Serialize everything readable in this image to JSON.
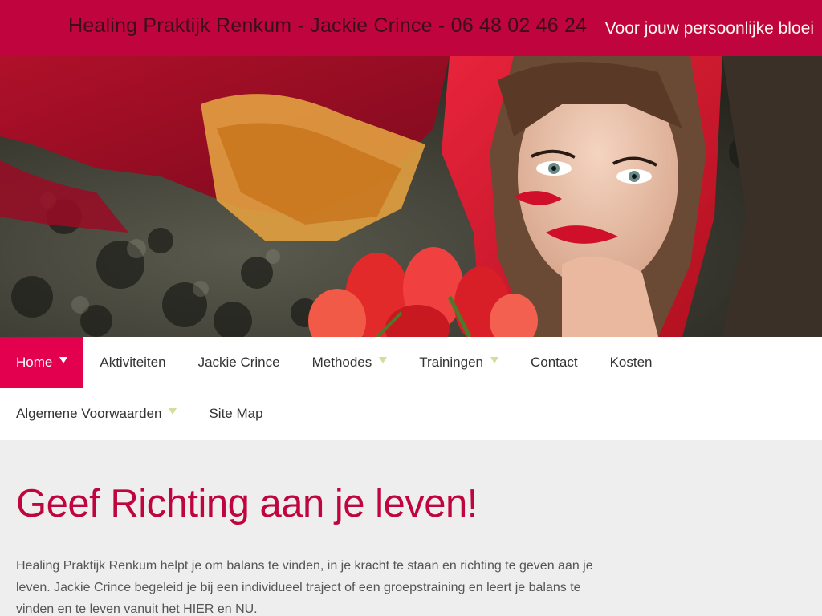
{
  "header": {
    "site_title": "Healing Praktijk Renkum - Jackie Crince - 06 48 02 46 24",
    "tagline": "Voor jouw persoonlijke bloei"
  },
  "hero": {
    "description": ""
  },
  "nav": {
    "row1": [
      {
        "label": "Home",
        "active": true,
        "has_submenu": true
      },
      {
        "label": "Aktiviteiten",
        "active": false,
        "has_submenu": false
      },
      {
        "label": "Jackie Crince",
        "active": false,
        "has_submenu": false
      },
      {
        "label": "Methodes",
        "active": false,
        "has_submenu": true
      },
      {
        "label": "Trainingen",
        "active": false,
        "has_submenu": true
      },
      {
        "label": "Contact",
        "active": false,
        "has_submenu": false
      },
      {
        "label": "Kosten",
        "active": false,
        "has_submenu": false
      }
    ],
    "row2": [
      {
        "label": "Algemene Voorwaarden",
        "active": false,
        "has_submenu": true
      },
      {
        "label": "Site Map",
        "active": false,
        "has_submenu": false
      }
    ]
  },
  "main": {
    "heading": "Geef Richting aan je leven!",
    "intro": "Healing Praktijk Renkum helpt je om balans te vinden, in je kracht te staan en richting te geven aan je leven. Jackie Crince begeleid je bij een individueel traject of een groepstraining en leert je balans te vinden en te leven vanuit het HIER en NU."
  },
  "colors": {
    "brand": "#c0043d",
    "active_nav": "#e2004f",
    "caret": "#d6dc9c"
  }
}
